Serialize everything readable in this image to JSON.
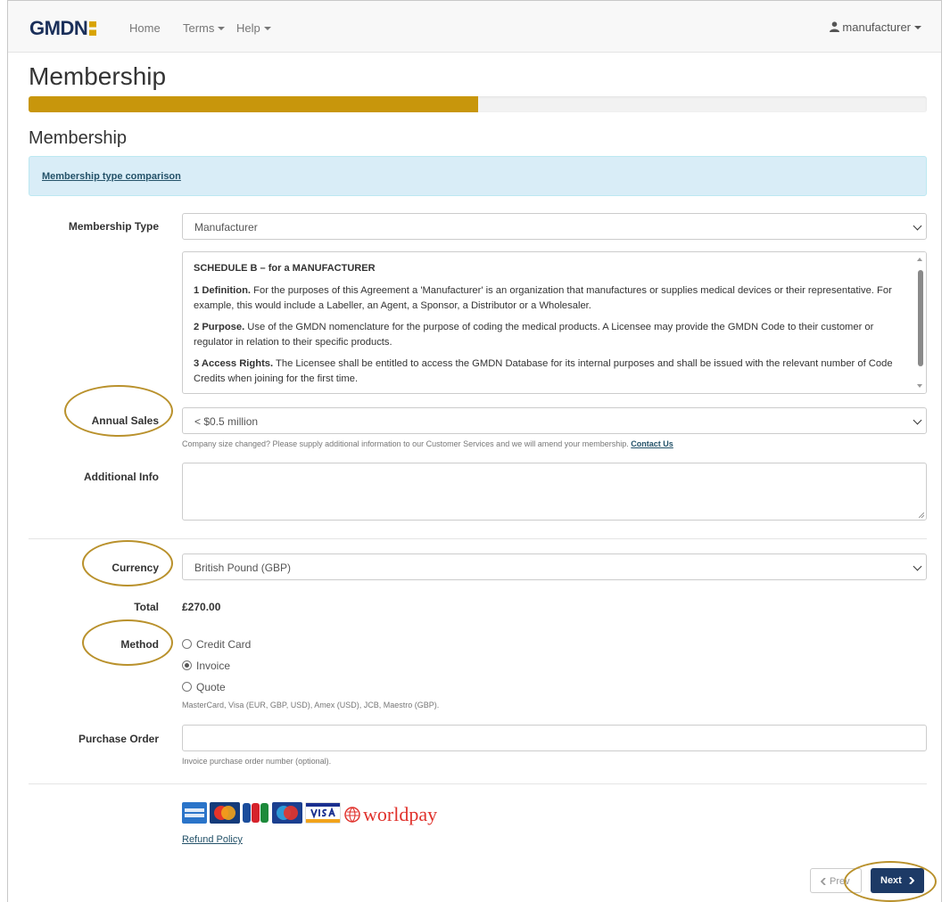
{
  "nav": {
    "brand": "GMDN",
    "home": "Home",
    "terms": "Terms",
    "help": "Help",
    "user": "manufacturer"
  },
  "page_title": "Membership",
  "progress_fraction": 0.5,
  "section_title": "Membership",
  "info_link": "Membership type comparison",
  "membership": {
    "label": "Membership Type",
    "value": "Manufacturer"
  },
  "terms": {
    "heading": "SCHEDULE B – for a MANUFACTURER",
    "p1_bold": "1 Definition.",
    "p1_text": " For the purposes of this Agreement a 'Manufacturer' is an organization that manufactures or supplies medical devices or their representative. For example, this would include a Labeller, an Agent, a Sponsor, a Distributor or a Wholesaler.",
    "p2_bold": "2 Purpose.",
    "p2_text": " Use of the GMDN nomenclature for the purpose of coding the medical products. A Licensee may provide the GMDN Code to their customer or regulator in relation to their specific products.",
    "p3_bold": "3 Access Rights.",
    "p3_text": " The Licensee shall be entitled to access the GMDN Database for its internal purposes and shall be issued with the relevant number of Code Credits when joining for the first time."
  },
  "annual_sales": {
    "label": "Annual Sales",
    "value": "< $0.5 million",
    "help": "Company size changed? Please supply additional information to our Customer Services and we will amend your membership.",
    "contact": "Contact Us"
  },
  "additional_info": {
    "label": "Additional Info",
    "value": ""
  },
  "currency": {
    "label": "Currency",
    "value": "British Pound (GBP)"
  },
  "total": {
    "label": "Total",
    "value": "£270.00"
  },
  "method": {
    "label": "Method",
    "options": [
      "Credit Card",
      "Invoice",
      "Quote"
    ],
    "selected": "Invoice",
    "note": "MasterCard, Visa (EUR, GBP, USD), Amex (USD), JCB, Maestro (GBP)."
  },
  "purchase_order": {
    "label": "Purchase Order",
    "value": "",
    "help": "Invoice purchase order number (optional)."
  },
  "payment_logos": [
    "amex",
    "mastercard",
    "jcb",
    "maestro",
    "visa",
    "worldpay"
  ],
  "worldpay_text": "worldpay",
  "refund_link": "Refund Policy",
  "buttons": {
    "prev": "Prev",
    "next": "Next"
  },
  "colors": {
    "accent": "#c8960c",
    "primary": "#1d3a66",
    "highlight_ring": "#b9912c"
  }
}
